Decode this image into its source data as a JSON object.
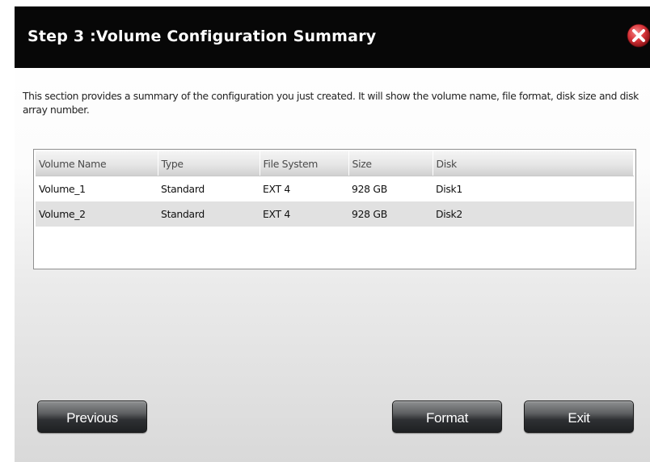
{
  "dialog": {
    "title": "Step 3 :Volume Configuration Summary",
    "description": "This section provides a summary of the configuration you just created. It will show the volume name, file format, disk size and disk array number."
  },
  "table": {
    "columns": [
      "Volume Name",
      "Type",
      "File System",
      "Size",
      "Disk"
    ],
    "rows": [
      [
        "Volume_1",
        "Standard",
        "EXT 4",
        "928 GB",
        "Disk1"
      ],
      [
        "Volume_2",
        "Standard",
        "EXT 4",
        "928 GB",
        "Disk2"
      ]
    ]
  },
  "buttons": {
    "previous": "Previous",
    "format": "Format",
    "exit": "Exit"
  },
  "icons": {
    "close": "close-icon"
  },
  "colors": {
    "title_bar": "#070707",
    "close_red": "#d9353a",
    "button_dark": "#2e3033"
  }
}
